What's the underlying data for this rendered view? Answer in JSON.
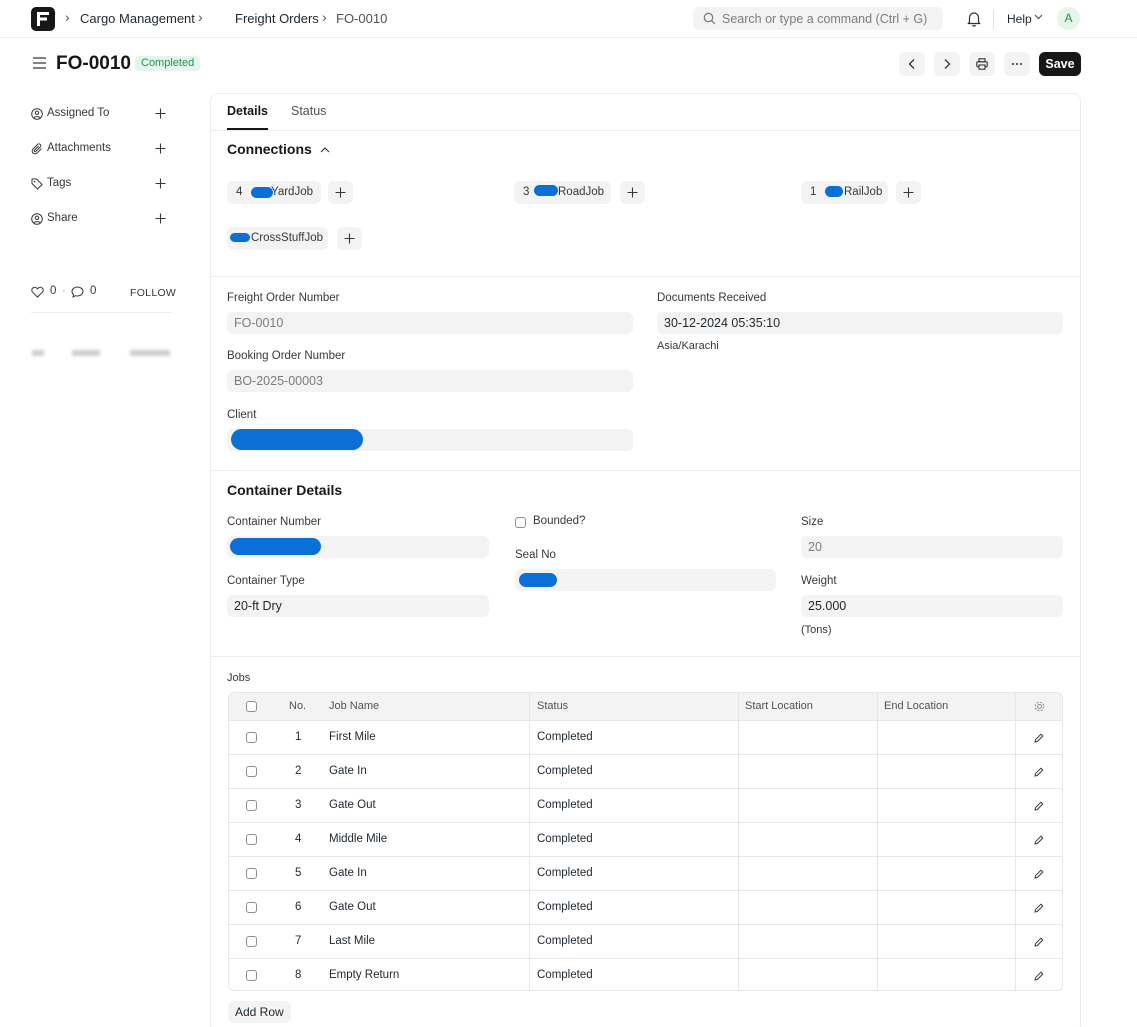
{
  "navbar": {
    "breadcrumbs": [
      "Cargo Management",
      "Freight Orders",
      "FO-0010"
    ],
    "search_placeholder": "Search or type a command (Ctrl + G)",
    "help_label": "Help",
    "avatar_initial": "A"
  },
  "page": {
    "title": "FO-0010",
    "status_badge": "Completed",
    "save_label": "Save"
  },
  "sidebar": {
    "items": [
      {
        "label": "Assigned To",
        "icon": "user-circle-icon"
      },
      {
        "label": "Attachments",
        "icon": "paperclip-icon"
      },
      {
        "label": "Tags",
        "icon": "tag-icon"
      },
      {
        "label": "Share",
        "icon": "share-user-icon"
      }
    ],
    "likes": "0",
    "comments": "0",
    "follow_label": "FOLLOW"
  },
  "tabs": [
    {
      "label": "Details",
      "active": true
    },
    {
      "label": "Status",
      "active": false
    }
  ],
  "connections": {
    "title": "Connections",
    "items": [
      {
        "count": "4",
        "name": "YardJob"
      },
      {
        "count": "3",
        "name": "RoadJob"
      },
      {
        "count": "1",
        "name": "RailJob"
      },
      {
        "count": "",
        "name": "CrossStuffJob"
      }
    ]
  },
  "order": {
    "freight_order_number_label": "Freight Order Number",
    "freight_order_number": "FO-0010",
    "booking_order_number_label": "Booking Order Number",
    "booking_order_number": "BO-2025-00003",
    "client_label": "Client",
    "documents_received_label": "Documents Received",
    "documents_received": "30-12-2024 05:35:10",
    "timezone": "Asia/Karachi"
  },
  "container": {
    "title": "Container Details",
    "container_number_label": "Container Number",
    "container_type_label": "Container Type",
    "container_type": "20-ft Dry",
    "bounded_label": "Bounded?",
    "seal_no_label": "Seal No",
    "size_label": "Size",
    "size": "20",
    "weight_label": "Weight",
    "weight": "25.000",
    "weight_unit": "(Tons)"
  },
  "jobs": {
    "title": "Jobs",
    "columns": [
      "No.",
      "Job Name",
      "Status",
      "Start Location",
      "End Location"
    ],
    "rows": [
      {
        "no": "1",
        "name": "First Mile",
        "status": "Completed"
      },
      {
        "no": "2",
        "name": "Gate In",
        "status": "Completed"
      },
      {
        "no": "3",
        "name": "Gate Out",
        "status": "Completed"
      },
      {
        "no": "4",
        "name": "Middle Mile",
        "status": "Completed"
      },
      {
        "no": "5",
        "name": "Gate In",
        "status": "Completed"
      },
      {
        "no": "6",
        "name": "Gate Out",
        "status": "Completed"
      },
      {
        "no": "7",
        "name": "Last Mile",
        "status": "Completed"
      },
      {
        "no": "8",
        "name": "Empty Return",
        "status": "Completed"
      }
    ],
    "add_row_label": "Add Row"
  },
  "colors": {
    "primary": "#171717",
    "success_bg": "#e4f5e9",
    "success_text": "#278f5e",
    "redaction": "#0b6fd8"
  }
}
